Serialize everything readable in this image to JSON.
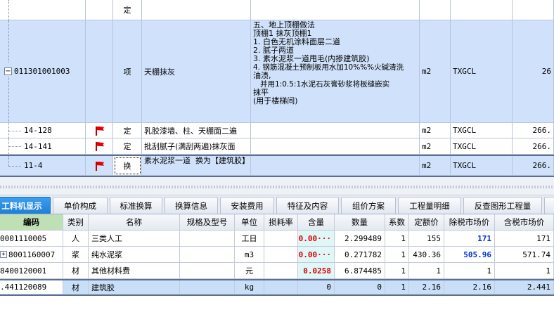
{
  "upper_rows": [
    {
      "code": "",
      "type": "定",
      "name": "",
      "desc": "",
      "unit": "",
      "formula": "",
      "qty": ""
    },
    {
      "code": "011301001003",
      "type": "项",
      "name": "天棚抹灰",
      "desc_lines": [
        "五、地上顶棚做法",
        "顶棚1   抹灰顶棚1",
        "1. 白色无机涂料面层二道",
        "2. 腻子两道",
        "3. 素水泥浆一道甩毛(内掺建筑胶)",
        "4. 钢筋混凝土预制板用水加10%%%火碱清洗",
        "油渍,",
        "   并用1:0.5:1水泥石灰膏砂浆将板缝嵌实",
        "抹平",
        "(用于楼梯间)"
      ],
      "unit": "m2",
      "formula": "TXGCL",
      "qty": "26"
    },
    {
      "code": "14-128",
      "type": "定",
      "name": "乳胶漆墙、柱、天棚面二遍",
      "unit": "m2",
      "formula": "TXGCL",
      "qty": "266."
    },
    {
      "code": "14-141",
      "type": "定",
      "name": "批刮腻子(满刮两遍)抹灰面",
      "unit": "m2",
      "formula": "TXGCL",
      "qty": "266."
    },
    {
      "code": "11-4",
      "type": "换",
      "name": "素水泥浆一道  换为【建筑胶】",
      "unit": "m2",
      "formula": "TXGCL",
      "qty": "266."
    }
  ],
  "tabs": [
    "工料机显示",
    "单价构成",
    "标准换算",
    "换算信息",
    "安装费用",
    "特征及内容",
    "组价方案",
    "工程量明细",
    "反查图形工程量",
    ""
  ],
  "columns": [
    "编码",
    "类别",
    "名称",
    "规格及型号",
    "单位",
    "损耗率",
    "含量",
    "数量",
    "系数",
    "定额价",
    "除税市场价",
    "含税市场价"
  ],
  "rows": [
    {
      "code": "0001110005",
      "cat": "人",
      "name": "三类人工",
      "spec": "",
      "unit": "工日",
      "loss": "",
      "content": "0.00···",
      "qty": "2.299489",
      "coef": "1",
      "price": "155",
      "market": "171",
      "tax": "171"
    },
    {
      "code": "8001160007",
      "cat": "浆",
      "name": "纯水泥浆",
      "spec": "",
      "unit": "m3",
      "loss": "",
      "content": "0.00···",
      "qty": "0.271782",
      "coef": "1",
      "price": "430.36",
      "market": "505.96",
      "tax": "571.74"
    },
    {
      "code": "8400120001",
      "cat": "材",
      "name": "其他材料费",
      "spec": "",
      "unit": "元",
      "loss": "",
      "content": "0.0258",
      "qty": "6.874485",
      "coef": "1",
      "price": "1",
      "market": "1",
      "tax": "1"
    },
    {
      "code": ".441120089",
      "cat": "材",
      "name": "建筑胶",
      "spec": "",
      "unit": "kg",
      "loss": "",
      "content": "0",
      "qty": "0",
      "coef": "1",
      "price": "2.16",
      "market": "2.16",
      "tax": "2.441"
    }
  ]
}
